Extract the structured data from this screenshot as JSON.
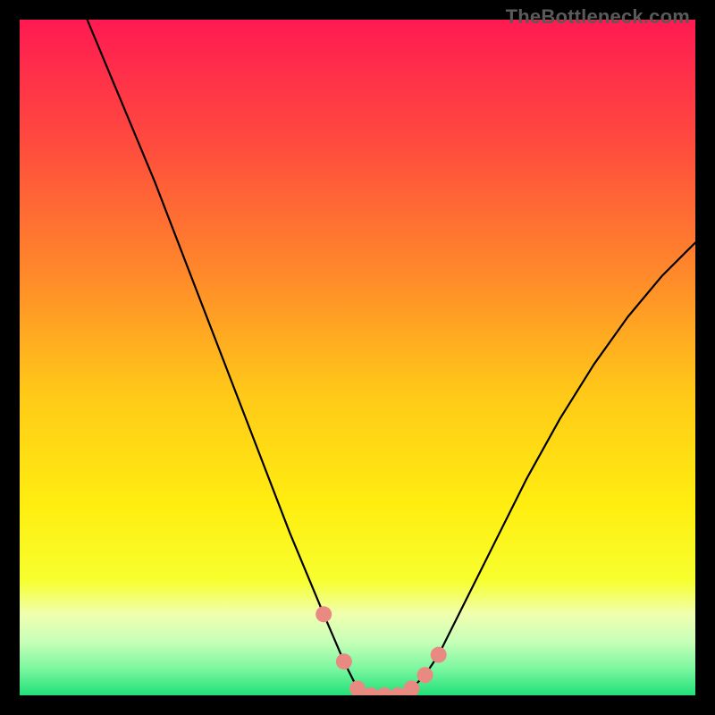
{
  "watermark": "TheBottleneck.com",
  "gradient": {
    "stops": [
      {
        "offset": 0.0,
        "color": "#ff1a52"
      },
      {
        "offset": 0.18,
        "color": "#ff4a3e"
      },
      {
        "offset": 0.38,
        "color": "#ff8a2a"
      },
      {
        "offset": 0.55,
        "color": "#ffc818"
      },
      {
        "offset": 0.72,
        "color": "#ffee10"
      },
      {
        "offset": 0.83,
        "color": "#f7ff2e"
      },
      {
        "offset": 0.88,
        "color": "#f0ffb0"
      },
      {
        "offset": 0.92,
        "color": "#c8ffb8"
      },
      {
        "offset": 0.96,
        "color": "#7cf7a0"
      },
      {
        "offset": 1.0,
        "color": "#20e078"
      }
    ]
  },
  "chart_data": {
    "type": "line",
    "title": "",
    "xlabel": "",
    "ylabel": "",
    "xlim": [
      0,
      100
    ],
    "ylim": [
      0,
      100
    ],
    "series": [
      {
        "name": "bottleneck-curve",
        "x": [
          10,
          15,
          20,
          25,
          30,
          35,
          40,
          45,
          48,
          50,
          52,
          54,
          56,
          58,
          60,
          62,
          65,
          70,
          75,
          80,
          85,
          90,
          95,
          100
        ],
        "y": [
          100,
          88,
          76,
          63,
          50,
          37,
          24,
          12,
          5,
          1,
          0,
          0,
          0,
          1,
          3,
          6,
          12,
          22,
          32,
          41,
          49,
          56,
          62,
          67
        ]
      }
    ],
    "markers": {
      "name": "highlight-range",
      "x": [
        45,
        48,
        50,
        52,
        54,
        56,
        58,
        60,
        62
      ],
      "y": [
        12,
        5,
        1,
        0,
        0,
        0,
        1,
        3,
        6
      ],
      "color": "#e98a82"
    }
  }
}
